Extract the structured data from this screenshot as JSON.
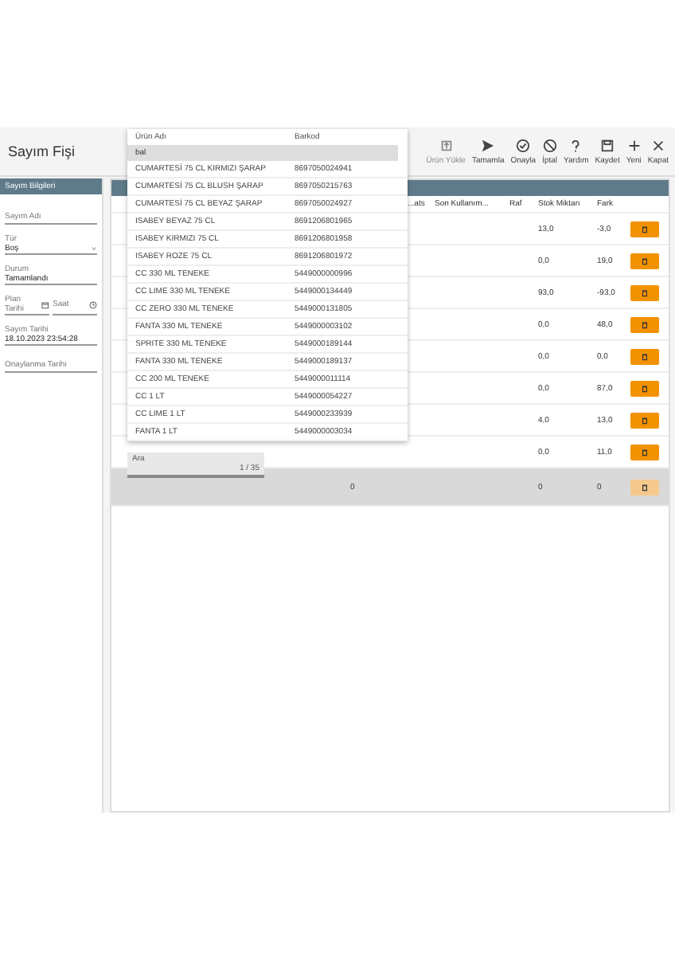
{
  "window": {
    "title": "Sayım Fişi"
  },
  "toolbar": [
    {
      "label": "Ürün Yükle",
      "kind": "upload",
      "disabled": true
    },
    {
      "label": "Tamamla",
      "kind": "send",
      "disabled": false
    },
    {
      "label": "Onayla",
      "kind": "approve",
      "disabled": false
    },
    {
      "label": "İptal",
      "kind": "cancel",
      "disabled": false
    },
    {
      "label": "Yardım",
      "kind": "help",
      "disabled": false
    },
    {
      "label": "Kaydet",
      "kind": "save",
      "disabled": false
    },
    {
      "label": "Yeni",
      "kind": "new",
      "disabled": false
    },
    {
      "label": "Kapat",
      "kind": "close",
      "disabled": false
    }
  ],
  "info_panel": {
    "title": "Sayım Bilgileri",
    "fields": [
      {
        "label": "Sayım Adı",
        "kind": "text"
      },
      {
        "label": "Tür",
        "value": "Boş",
        "kind": "select"
      },
      {
        "label": "Durum",
        "value": "Tamamlandı",
        "kind": "text"
      },
      {
        "kind": "datetime",
        "label": "Plan Tarihi",
        "label_2": "Saat"
      },
      {
        "label": "Sayım Tarihi",
        "value": "18.10.2023 23:54:28",
        "kind": "text"
      },
      {
        "label": "Onaylanma Tarihi",
        "kind": "text"
      }
    ]
  },
  "table": {
    "columns": [
      "...ats",
      "Son Kullanım...",
      "Raf",
      "Stok Miktarı",
      "Fark"
    ],
    "rows": [
      {
        "stock": "13,0",
        "diff": "-3,0"
      },
      {
        "stock": "0,0",
        "diff": "19,0"
      },
      {
        "stock": "93,0",
        "diff": "-93,0"
      },
      {
        "stock": "0,0",
        "diff": "48,0"
      },
      {
        "stock": "0,0",
        "diff": "0,0"
      },
      {
        "stock": "0,0",
        "diff": "87,0"
      },
      {
        "stock": "4,0",
        "diff": "13,0"
      },
      {
        "stock": "0,0",
        "diff": "11,0"
      }
    ],
    "new_row": {
      "column_1": "0",
      "stock": "0",
      "diff": "0"
    }
  },
  "dropdown": {
    "columns": [
      "Ürün Adı",
      "Barkod"
    ],
    "search": "bal",
    "items": [
      {
        "name": "CUMARTESİ 75 CL KIRMIZI ŞARAP",
        "barcode": "8697050024941"
      },
      {
        "name": "CUMARTESİ 75 CL BLUSH ŞARAP",
        "barcode": "8697050215763"
      },
      {
        "name": "CUMARTESİ 75 CL BEYAZ ŞARAP",
        "barcode": "8697050024927"
      },
      {
        "name": "ISABEY BEYAZ 75 CL",
        "barcode": "8691206801965"
      },
      {
        "name": "ISABEY KIRMIZI 75 CL",
        "barcode": "8691206801958"
      },
      {
        "name": "ISABEY ROZE 75 CL",
        "barcode": "8691206801972"
      },
      {
        "name": "CC 330 ML TENEKE",
        "barcode": "5449000000996"
      },
      {
        "name": "CC LIME 330 ML TENEKE",
        "barcode": "5449000134449"
      },
      {
        "name": "CC ZERO 330 ML TENEKE",
        "barcode": "5449000131805"
      },
      {
        "name": "FANTA 330 ML TENEKE",
        "barcode": "5449000003102"
      },
      {
        "name": "SPRITE 330 ML TENEKE",
        "barcode": "5449000189144"
      },
      {
        "name": "FANTA 330 ML TENEKE",
        "barcode": "5449000189137"
      },
      {
        "name": "CC 200 ML TENEKE",
        "barcode": "5449000011114"
      },
      {
        "name": "CC 1 LT",
        "barcode": "5449000054227"
      },
      {
        "name": "CC LIME 1 LT",
        "barcode": "5449000233939"
      },
      {
        "name": "FANTA 1 LT",
        "barcode": "5449000003034"
      }
    ],
    "pager": {
      "label": "Ara",
      "count": "1 / 35"
    }
  }
}
